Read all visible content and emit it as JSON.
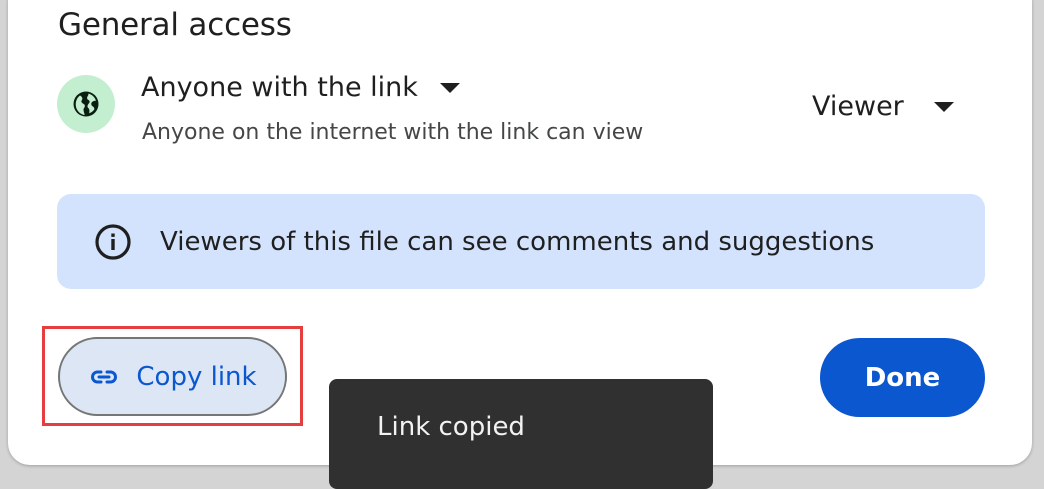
{
  "general_access": {
    "title": "General access",
    "access_level": "Anyone with the link",
    "access_description": "Anyone on the internet with the link can view",
    "role": "Viewer",
    "globe_icon": "globe-icon",
    "avatar_color": "#c4eed0"
  },
  "info_banner": {
    "icon": "info-icon",
    "text": "Viewers of this file can see comments and suggestions",
    "background": "#d3e3fd"
  },
  "actions": {
    "copy_link_label": "Copy link",
    "copy_link_icon": "link-icon",
    "done_label": "Done",
    "accent_color": "#0b57d0",
    "highlight_color": "#e53e3e"
  },
  "toast": {
    "text": "Link copied"
  }
}
